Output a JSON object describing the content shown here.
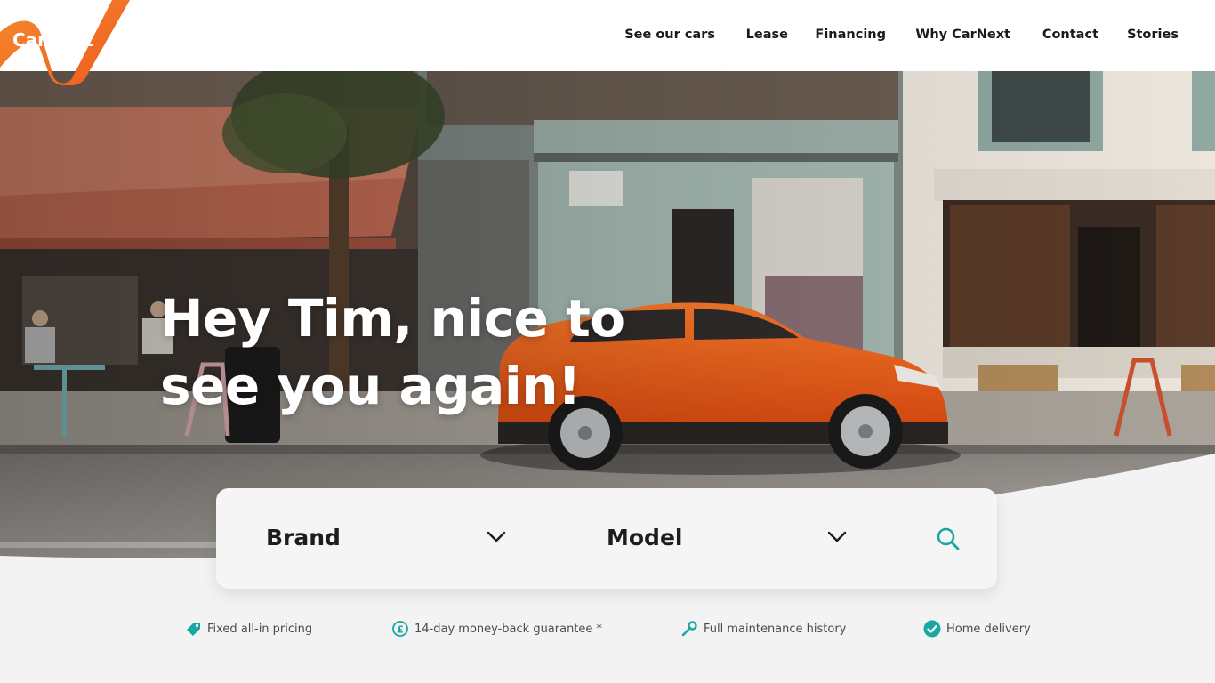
{
  "brand": {
    "logo_text": "CarNext",
    "accent": "#f06b23",
    "teal": "#1aa7a4"
  },
  "nav": {
    "items": [
      {
        "label": "See our cars"
      },
      {
        "label": "Lease"
      },
      {
        "label": "Financing"
      },
      {
        "label": "Why CarNext"
      },
      {
        "label": "Contact"
      },
      {
        "label": "Stories"
      }
    ]
  },
  "hero": {
    "title_line1": "Hey Tim, nice to",
    "title_line2": "see you again!"
  },
  "search": {
    "brand_label": "Brand",
    "model_label": "Model",
    "icons": {
      "dropdown": "chevron-down-icon",
      "submit": "search-icon"
    }
  },
  "features": [
    {
      "label": "Fixed all-in pricing",
      "icon": "price-tag-icon"
    },
    {
      "label": "14-day money-back guarantee *",
      "icon": "pound-refund-icon"
    },
    {
      "label": "Full maintenance history",
      "icon": "wrench-icon"
    },
    {
      "label": "Home delivery",
      "icon": "check-circle-icon"
    }
  ]
}
